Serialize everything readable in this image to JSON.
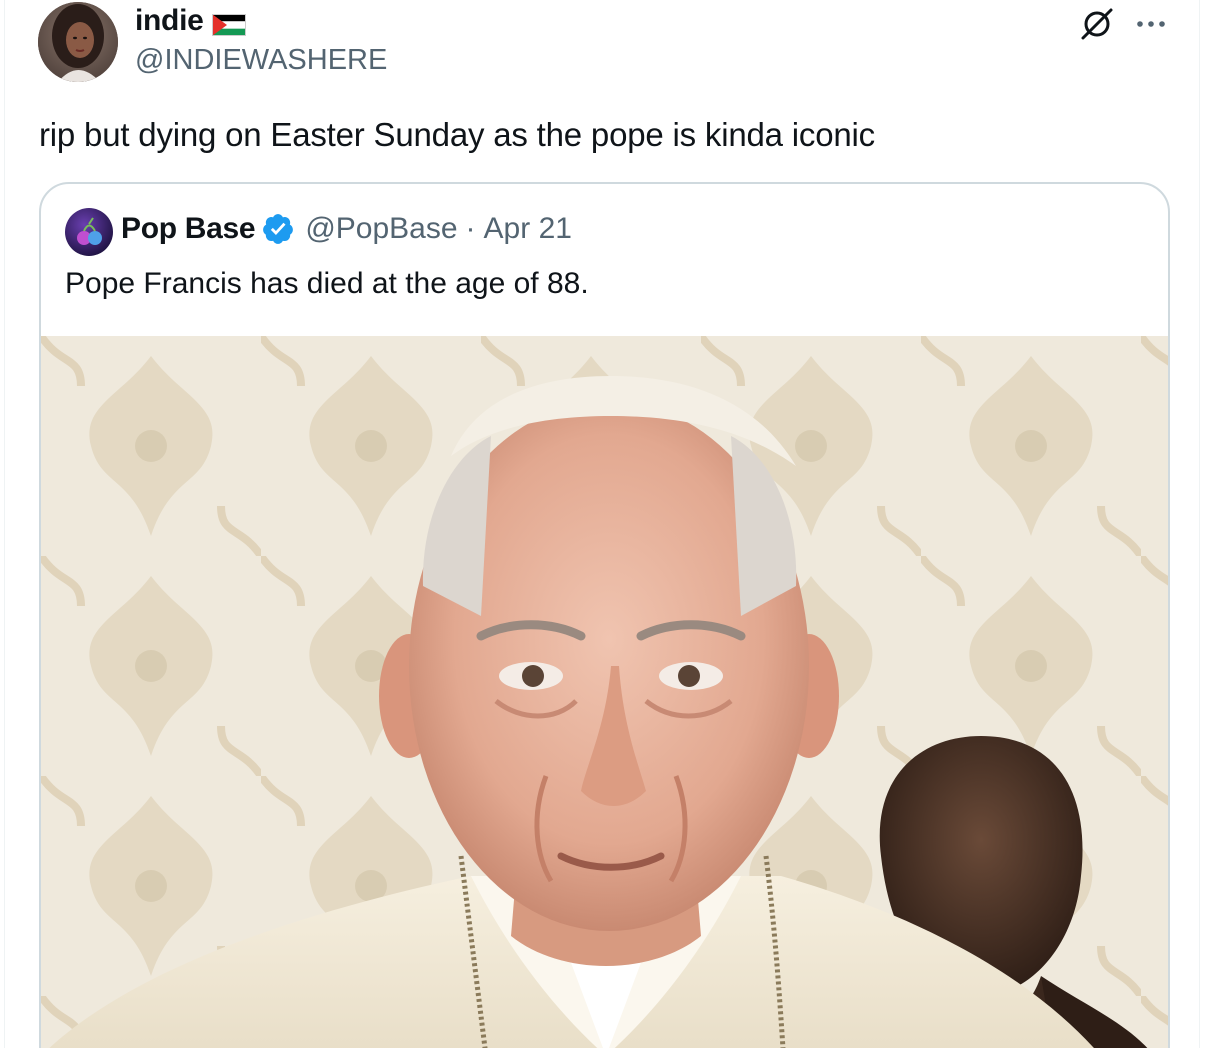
{
  "author": {
    "display_name": "indie",
    "handle": "@INDIEWASHERE",
    "flag_icon": "palestine-flag-icon"
  },
  "tweet": {
    "text": "rip but dying on Easter Sunday as the pope is kinda iconic"
  },
  "actions": {
    "grok_icon": "grok-icon",
    "more_icon": "more-options-icon"
  },
  "quoted_tweet": {
    "display_name": "Pop Base",
    "verified_icon": "verified-badge-icon",
    "handle": "@PopBase",
    "separator": "·",
    "date": "Apr 21",
    "text": "Pope Francis has died at the age of 88.",
    "media_description_icon": "photo-of-pope-francis"
  },
  "colors": {
    "text_primary": "#0f1419",
    "text_secondary": "#536471",
    "border": "#cfd9de",
    "verified_blue": "#1d9bf0",
    "photo_wallpaper": "#efe9dc",
    "photo_vestment": "#f1ead6"
  }
}
